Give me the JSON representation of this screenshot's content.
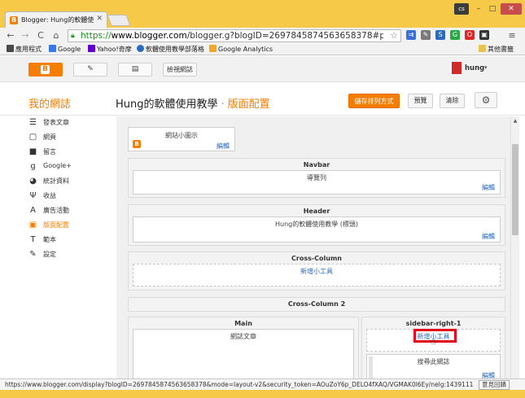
{
  "browser": {
    "tab_title": "Blogger: Hung的軟體使",
    "window_controls": {
      "badge": "cs",
      "min": "–",
      "max": "□",
      "close": "✕"
    },
    "url_scheme": "https://",
    "url_host": "www.blogger.com",
    "url_path": "/blogger.g?blogID=2697845874563658378#pageelem",
    "bookmarks": [
      {
        "label": "應用程式",
        "icon_color": "#4a4a4a"
      },
      {
        "label": "Google",
        "icon_color": "#3b78e7"
      },
      {
        "label": "Yahoo!奇摩",
        "icon_color": "#5f01d1"
      },
      {
        "label": "軟體使用教學部落格",
        "icon_color": "#2a6bbf"
      },
      {
        "label": "Google Analytics",
        "icon_color": "#f5a623"
      }
    ],
    "other_bookmarks": "其他書籤",
    "status_url": "https://www.blogger.com/display?blogID=2697845874563658378&mode=layout-v2&security_token=AOuZoY6p_DELO4fXAQ/VGMAK0l6Ey/nelg:1439111400072",
    "feedback": "意見回饋"
  },
  "header": {
    "view_blog": "檢視網誌",
    "user_name": "hung",
    "blog_link": "我的網誌",
    "blog_title": "Hung的軟體使用教學",
    "separator": "·",
    "section": "版面配置",
    "save_label": "儲存排列方式",
    "preview_label": "預覽",
    "clear_label": "清除"
  },
  "sidebar": {
    "items": [
      {
        "label": "發表文章",
        "icon": "posts-icon",
        "glyph": "☰"
      },
      {
        "label": "網頁",
        "icon": "pages-icon",
        "glyph": "▢"
      },
      {
        "label": "留言",
        "icon": "comments-icon",
        "glyph": "■"
      },
      {
        "label": "Google+",
        "icon": "gplus-icon",
        "glyph": "g"
      },
      {
        "label": "統計資料",
        "icon": "stats-icon",
        "glyph": "◕"
      },
      {
        "label": "收益",
        "icon": "earnings-icon",
        "glyph": "Ψ"
      },
      {
        "label": "廣告活動",
        "icon": "campaigns-icon",
        "glyph": "A"
      },
      {
        "label": "版面配置",
        "icon": "layout-icon",
        "glyph": "▣"
      },
      {
        "label": "範本",
        "icon": "template-icon",
        "glyph": "T"
      },
      {
        "label": "設定",
        "icon": "wrench-icon",
        "glyph": "✎"
      }
    ],
    "active_index": 7
  },
  "layout": {
    "favicon_widget": {
      "label": "網站小圖示",
      "edit": "編輯"
    },
    "navbar": {
      "title": "Navbar",
      "widget": "導覽列",
      "edit": "編輯"
    },
    "header": {
      "title": "Header",
      "widget": "Hung的軟體使用教學 (標頭)",
      "edit": "編輯"
    },
    "cross_column": {
      "title": "Cross-Column",
      "add": "新增小工具"
    },
    "cross_column_2": {
      "title": "Cross-Column 2"
    },
    "main": {
      "title": "Main",
      "widget": "網誌文章"
    },
    "sidebar_right": {
      "title": "sidebar-right-1",
      "add": "新增小工具",
      "widget": "搜尋此網誌",
      "edit": "編輯"
    }
  }
}
